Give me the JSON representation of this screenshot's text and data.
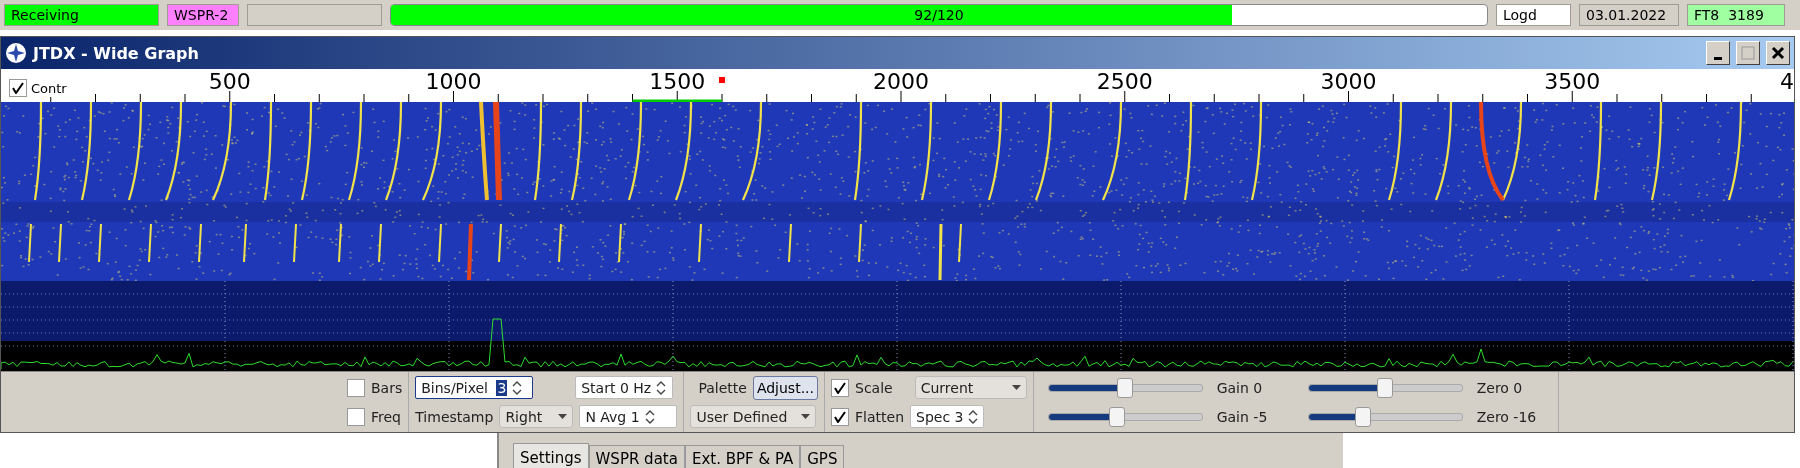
{
  "status_bar": {
    "state": "Receiving",
    "mode": "WSPR-2",
    "progress": {
      "label": "92/120",
      "level": 0.767
    },
    "log": "Logd",
    "date": "03.01.2022",
    "band_info": "FT8  3189"
  },
  "window": {
    "title": "JTDX - Wide Graph"
  },
  "scale": {
    "labels": [
      "500",
      "1000",
      "1500",
      "2000",
      "2500",
      "3000",
      "3500",
      "4"
    ],
    "controls_toggle": {
      "label": "Contr",
      "checked": true
    }
  },
  "controls": {
    "bars": {
      "label": "Bars",
      "checked": false
    },
    "freq": {
      "label": "Freq",
      "checked": false
    },
    "bins_per_pixel": {
      "label": "Bins/Pixel",
      "value": "3"
    },
    "start": "Start 0 Hz",
    "timestamp": {
      "label": "Timestamp",
      "value": "Right"
    },
    "n_avg": "N Avg 1",
    "palette": {
      "label": "Palette",
      "button": "Adjust...",
      "value": "User Defined"
    },
    "scale": {
      "label": "Scale",
      "checked": true
    },
    "flatten": {
      "label": "Flatten",
      "checked": true
    },
    "spectrum": "Current",
    "spec": "Spec 3",
    "sliders": [
      {
        "label": "Gain 0",
        "level": 0.5
      },
      {
        "label": "Zero 0",
        "level": 0.5
      },
      {
        "label": "Gain -5",
        "level": 0.45
      },
      {
        "label": "Zero -16",
        "level": 0.36
      }
    ]
  },
  "tabs": [
    {
      "label": "Settings",
      "selected": true
    },
    {
      "label": "WSPR data",
      "selected": false
    },
    {
      "label": "Ext. BPF & PA",
      "selected": false
    },
    {
      "label": "GPS",
      "selected": false
    }
  ]
}
